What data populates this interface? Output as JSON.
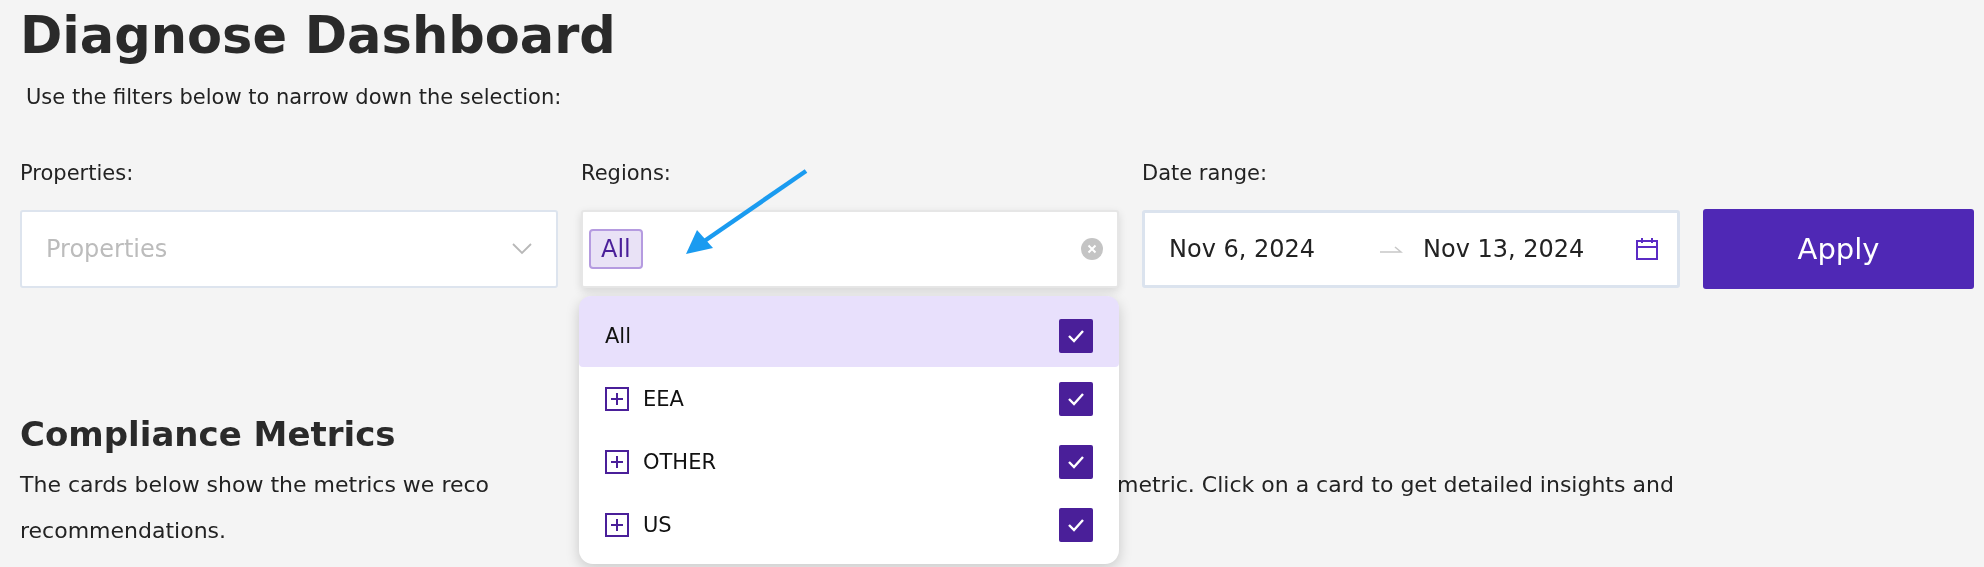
{
  "title": "Diagnose Dashboard",
  "subtitle": "Use the filters below to narrow down the selection:",
  "filters": [
    {
      "kind": "select",
      "label": "Properties:",
      "placeholder": "Properties"
    },
    {
      "kind": "tags",
      "label": "Regions:",
      "tags": [
        "All"
      ]
    },
    {
      "kind": "daterange",
      "label": "Date range:",
      "start": "Nov 6, 2024",
      "end": "Nov 13, 2024"
    }
  ],
  "apply_button": "Apply",
  "regions_dropdown": {
    "options": [
      {
        "label": "All",
        "expandable": false,
        "checked": true,
        "selected": true
      },
      {
        "label": "EEA",
        "expandable": true,
        "checked": true,
        "selected": false
      },
      {
        "label": "OTHER",
        "expandable": true,
        "checked": true,
        "selected": false
      },
      {
        "label": "US",
        "expandable": true,
        "checked": true,
        "selected": false
      }
    ]
  },
  "section": {
    "heading": "Compliance Metrics",
    "text_left": "The cards below show the metrics we reco",
    "text_right": "metric. Click on a card to get detailed insights and",
    "text_line_2": "recommendations."
  }
}
